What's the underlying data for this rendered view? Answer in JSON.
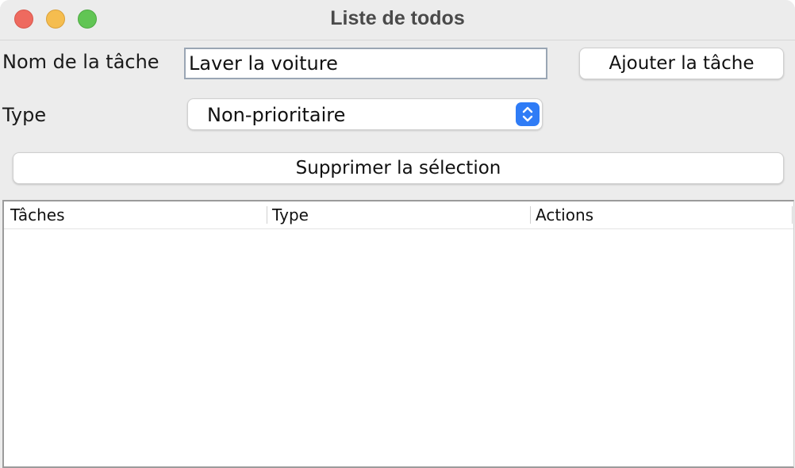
{
  "window": {
    "title": "Liste de todos"
  },
  "form": {
    "task_name_label": "Nom de la tâche",
    "task_name_value": "Laver la voiture",
    "add_button_label": "Ajouter la tâche",
    "type_label": "Type",
    "type_selected": "Non-prioritaire",
    "delete_selection_label": "Supprimer la sélection"
  },
  "table": {
    "columns": [
      "Tâches",
      "Type",
      "Actions"
    ],
    "rows": []
  },
  "colors": {
    "close": "#ee6a5f",
    "minimize": "#f5bd4f",
    "maximize": "#61c554",
    "select_accent": "#2f7cf6"
  }
}
